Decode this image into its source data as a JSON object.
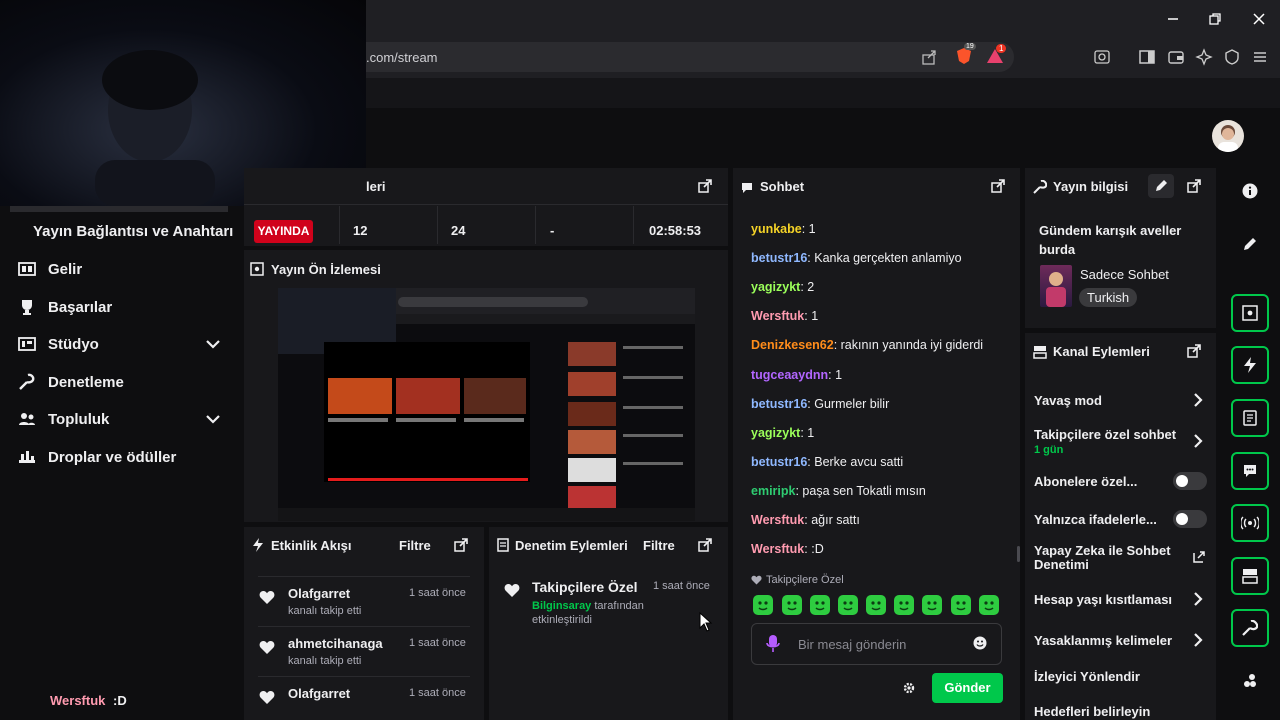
{
  "browser": {
    "url": ".com/stream",
    "brave_badge": "19",
    "alert_badge": "1"
  },
  "sidebar": {
    "header": "Yayın Bağlantısı ve Anahtarı",
    "items": [
      {
        "label": "Gelir",
        "icon": "revenue-icon"
      },
      {
        "label": "Başarılar",
        "icon": "trophy-icon"
      },
      {
        "label": "Stüdyo",
        "icon": "studio-icon",
        "expandable": true
      },
      {
        "label": "Denetleme",
        "icon": "wrench-icon"
      },
      {
        "label": "Topluluk",
        "icon": "community-icon",
        "expandable": true
      },
      {
        "label": "Droplar ve ödüller",
        "icon": "drops-icon"
      }
    ]
  },
  "overlay_chat": {
    "user": "Wersftuk",
    "message": ":D"
  },
  "stats_panel": {
    "title_fragment": "leri",
    "live_badge": "YAYINDA",
    "values": [
      "12",
      "24",
      "-",
      "02:58:53"
    ]
  },
  "preview": {
    "title": "Yayın Ön İzlemesi"
  },
  "activity_feed": {
    "title": "Etkinlik Akışı",
    "filter_label": "Filtre",
    "items": [
      {
        "user": "Olafgarret",
        "action": "kanalı takip etti",
        "time": "1 saat önce"
      },
      {
        "user": "ahmetcihanaga",
        "action": "kanalı takip etti",
        "time": "1 saat önce"
      },
      {
        "user": "Olafgarret",
        "action": "",
        "time": "1 saat önce"
      }
    ]
  },
  "mod_actions": {
    "title": "Denetim Eylemleri",
    "filter_label": "Filtre",
    "item": {
      "title": "Takipçilere Özel",
      "time": "1 saat önce",
      "actor": "Bilginsaray",
      "action_line1": "tarafından",
      "action_line2": "etkinleştirildi"
    }
  },
  "chat": {
    "title": "Sohbet",
    "messages": [
      {
        "user": "yunkabe",
        "text": "1",
        "color": "#f5d327"
      },
      {
        "user": "betustr16",
        "text": "Kanka gerçekten anlamiyo",
        "color": "#8fb8ff"
      },
      {
        "user": "yagizykt",
        "text": "2",
        "color": "#9bff5a"
      },
      {
        "user": "Wersftuk",
        "text": "1",
        "color": "#ff9bb0"
      },
      {
        "user": "Denizkesen62",
        "text": "rakının yanında iyi giderdi",
        "color": "#ff8c1a"
      },
      {
        "user": "tugceaaydnn",
        "text": "1",
        "color": "#b266ff"
      },
      {
        "user": "betustr16",
        "text": "Gurmeler bilir",
        "color": "#8fb8ff"
      },
      {
        "user": "yagizykt",
        "text": "1",
        "color": "#9bff5a"
      },
      {
        "user": "betustr16",
        "text": "Berke avcu satti",
        "color": "#8fb8ff"
      },
      {
        "user": "emiripk",
        "text": "paşa sen Tokatli mısın",
        "color": "#2ecc71"
      },
      {
        "user": "Wersftuk",
        "text": "ağır sattı",
        "color": "#ff9bb0"
      },
      {
        "user": "Wersftuk",
        "text": ":D",
        "color": "#ff9bb0"
      }
    ],
    "followers_only_label": "Takipçilere Özel",
    "input_placeholder": "Bir mesaj gönderin",
    "send_label": "Gönder"
  },
  "stream_info": {
    "title": "Yayın bilgisi",
    "stream_title": "Gündem karışık aveller burda",
    "category": "Sadece Sohbet",
    "tag": "Turkish"
  },
  "channel_actions": {
    "title": "Kanal Eylemleri",
    "items": [
      {
        "label": "Yavaş mod",
        "control": "chevron"
      },
      {
        "label": "Takipçilere özel sohbet",
        "sub": "1 gün",
        "control": "chevron"
      },
      {
        "label": "Abonelere özel...",
        "control": "toggle"
      },
      {
        "label": "Yalnızca ifadelerle...",
        "control": "toggle"
      },
      {
        "label": "Yapay Zeka ile Sohbet Denetimi",
        "control": "external"
      },
      {
        "label": "Hesap yaşı kısıtlaması",
        "control": "chevron"
      },
      {
        "label": "Yasaklanmış kelimeler",
        "control": "chevron"
      },
      {
        "label": "İzleyici Yönlendir",
        "control": "none"
      },
      {
        "label": "Hedefleri belirleyin",
        "control": "none"
      }
    ]
  },
  "colors": {
    "accent": "#00c84b",
    "live_red": "#d0021b",
    "panel": "#18181b",
    "background": "#0e0e10"
  }
}
